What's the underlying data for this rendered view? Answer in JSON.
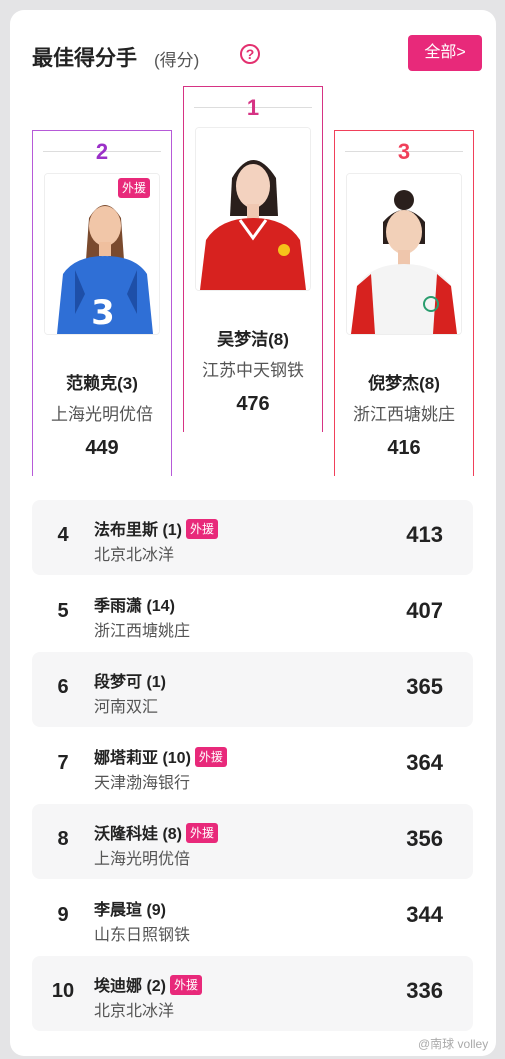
{
  "header": {
    "title": "最佳得分手",
    "subtitle": "(得分)",
    "help_glyph": "?",
    "all_button": "全部>"
  },
  "badge_label": "外援",
  "colors": {
    "accent": "#e8297a",
    "rank1": "#d63384",
    "rank2": "#9b30c8",
    "rank3": "#f0405a"
  },
  "podium": [
    {
      "rank": "1",
      "name": "吴梦洁(8)",
      "team": "江苏中天钢铁",
      "score": "476",
      "foreign": false,
      "jersey": "red"
    },
    {
      "rank": "2",
      "name": "范赖克(3)",
      "team": "上海光明优倍",
      "score": "449",
      "foreign": true,
      "jersey": "blue",
      "jersey_number": "3"
    },
    {
      "rank": "3",
      "name": "倪梦杰(8)",
      "team": "浙江西塘姚庄",
      "score": "416",
      "foreign": false,
      "jersey": "white"
    }
  ],
  "rankings": [
    {
      "rank": "4",
      "name": "法布里斯 (1)",
      "team": "北京北冰洋",
      "score": "413",
      "foreign": true
    },
    {
      "rank": "5",
      "name": "季雨潇 (14)",
      "team": "浙江西塘姚庄",
      "score": "407",
      "foreign": false
    },
    {
      "rank": "6",
      "name": "段梦可 (1)",
      "team": "河南双汇",
      "score": "365",
      "foreign": false
    },
    {
      "rank": "7",
      "name": "娜塔莉亚 (10)",
      "team": "天津渤海银行",
      "score": "364",
      "foreign": true
    },
    {
      "rank": "8",
      "name": "沃隆科娃 (8)",
      "team": "上海光明优倍",
      "score": "356",
      "foreign": true
    },
    {
      "rank": "9",
      "name": "李晨瑄 (9)",
      "team": "山东日照钢铁",
      "score": "344",
      "foreign": false
    },
    {
      "rank": "10",
      "name": "埃迪娜 (2)",
      "team": "北京北冰洋",
      "score": "336",
      "foreign": true
    }
  ],
  "watermark": "@南球 volley"
}
